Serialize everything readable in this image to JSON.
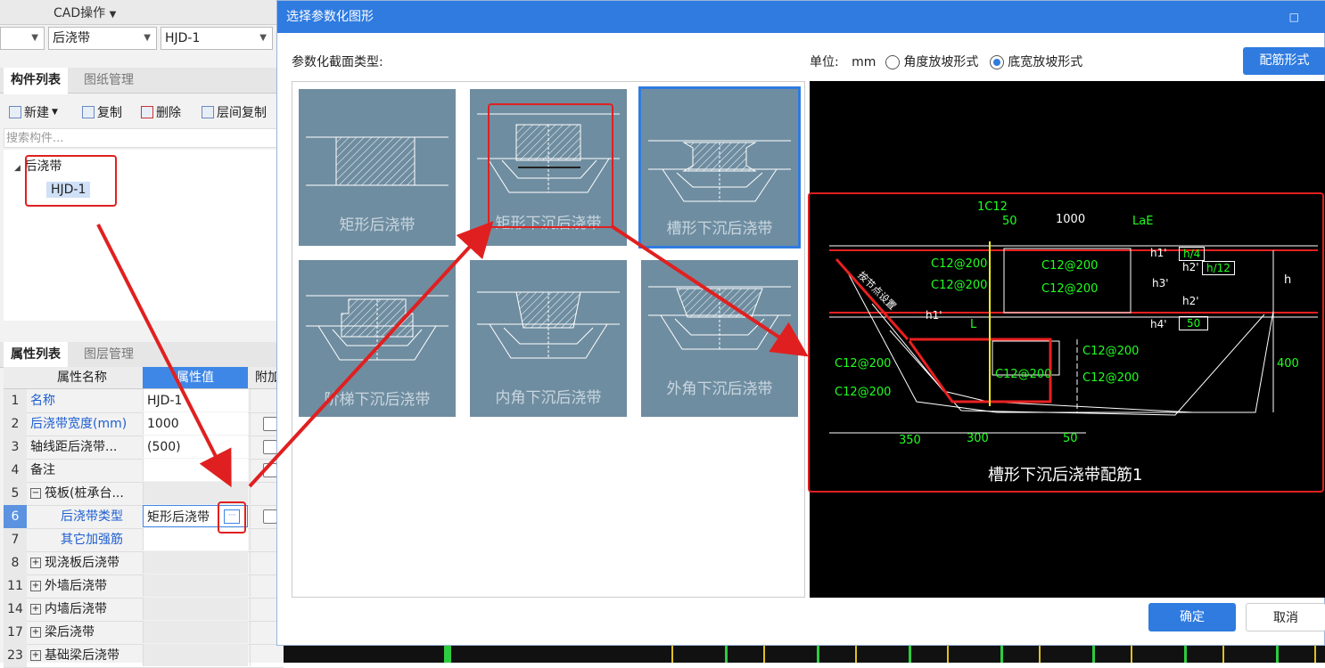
{
  "left": {
    "cad_menu": "CAD操作",
    "dropdown1": "后浇带",
    "dropdown2": "HJD-1",
    "tabs_top": [
      "构件列表",
      "图纸管理"
    ],
    "toolbar": {
      "new": "新建",
      "copy": "复制",
      "delete": "删除",
      "floor_copy": "层间复制"
    },
    "search_placeholder": "搜索构件...",
    "tree": {
      "root": "后浇带",
      "child": "HJD-1"
    },
    "tabs_bottom": [
      "属性列表",
      "图层管理"
    ],
    "grid_headers": {
      "name": "属性名称",
      "value": "属性值",
      "extra": "附加"
    },
    "rows": [
      {
        "n": "1",
        "k": "名称",
        "v": "HJD-1"
      },
      {
        "n": "2",
        "k": "后浇带宽度(mm)",
        "v": "1000"
      },
      {
        "n": "3",
        "k": "轴线距后浇带...",
        "v": "(500)"
      },
      {
        "n": "4",
        "k": "备注",
        "v": ""
      },
      {
        "n": "5",
        "k": "筏板(桩承台...",
        "v": ""
      },
      {
        "n": "6",
        "k": "后浇带类型",
        "v": "矩形后浇带"
      },
      {
        "n": "7",
        "k": "其它加强筋",
        "v": ""
      },
      {
        "n": "8",
        "k": "现浇板后浇带",
        "v": ""
      },
      {
        "n": "11",
        "k": "外墙后浇带",
        "v": ""
      },
      {
        "n": "14",
        "k": "内墙后浇带",
        "v": ""
      },
      {
        "n": "17",
        "k": "梁后浇带",
        "v": ""
      },
      {
        "n": "23",
        "k": "基础梁后浇带",
        "v": ""
      }
    ],
    "ellipsis": "···"
  },
  "dialog": {
    "title": "选择参数化图形",
    "section_label": "参数化截面类型:",
    "unit_label": "单位:",
    "unit_value": "mm",
    "radio1": "角度放坡形式",
    "radio2": "底宽放坡形式",
    "rebar_button": "配筋形式",
    "thumbs": [
      "矩形后浇带",
      "矩形下沉后浇带",
      "槽形下沉后浇带",
      "阶梯下沉后浇带",
      "内角下沉后浇带",
      "外角下沉后浇带"
    ],
    "preview": {
      "caption": "槽形下沉后浇带配筋1",
      "labels": {
        "top_bar": "1C12",
        "d50a": "50",
        "d1000": "1000",
        "lae": "LaE",
        "r1": "C12@200",
        "r2": "C12@200",
        "r3": "C12@200",
        "r4": "C12@200",
        "r5": "C12@200",
        "r6": "C12@200",
        "r7": "C12@200",
        "r8": "C12@200",
        "r9": "C12@200",
        "h1p": "h1'",
        "h4": "h/4",
        "h2p": "h2'",
        "h12": "h/12",
        "h3p": "h3'",
        "h2p2": "h2'",
        "h1p2": "h1'",
        "h4p": "h4'",
        "d50b": "50",
        "h": "h",
        "d400": "400",
        "L": "L",
        "d350": "350",
        "d300": "300",
        "d50c": "50",
        "diag": "按节点设置"
      }
    },
    "ok": "确定",
    "cancel": "取消",
    "maximize": "□"
  }
}
